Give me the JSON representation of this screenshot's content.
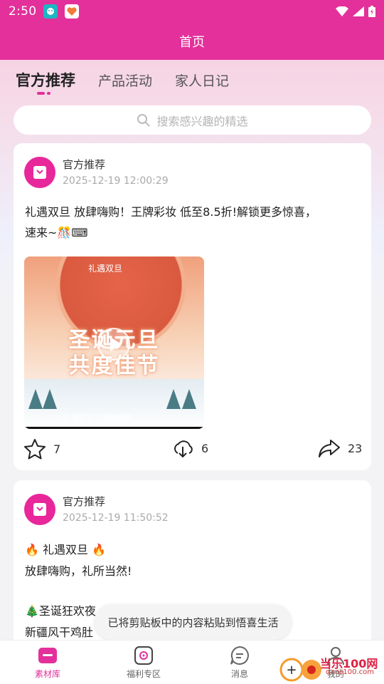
{
  "status_bar": {
    "time": "2:50"
  },
  "app_bar": {
    "title": "首页"
  },
  "tabs": [
    {
      "label": "官方推荐",
      "active": true
    },
    {
      "label": "产品活动",
      "active": false
    },
    {
      "label": "家人日记",
      "active": false
    }
  ],
  "search": {
    "placeholder": "搜索感兴趣的精选"
  },
  "posts": [
    {
      "author": "官方推荐",
      "time": "2025-12-19 12:00:29",
      "text_line1": " 礼遇双旦  放肆嗨购！王牌彩妆 低至8.5折!解锁更多惊喜，",
      "text_line2": "速来~🎊⌨",
      "video": {
        "top_text": "礼遇双旦",
        "headline_1": "圣诞元旦",
        "headline_2": "共度佳节",
        "caption": "礼遇双旦 · 放肆嗨购"
      },
      "likes": "7",
      "downloads": "6",
      "shares": "23"
    },
    {
      "author": "官方推荐",
      "time": "2025-12-19 11:50:52",
      "line1": "🔥 礼遇双旦 🔥",
      "line2": "放肆嗨购，礼所当然!",
      "line3": "🎄圣诞狂欢夜",
      "line4": "新疆风干鸡肚"
    }
  ],
  "toast": "已将剪贴板中的内容粘贴到悟喜生活",
  "bottom_nav": [
    {
      "label": "素材库",
      "active": true
    },
    {
      "label": "福利专区",
      "active": false
    },
    {
      "label": "消息",
      "active": false
    },
    {
      "label": "我的",
      "active": false
    }
  ],
  "watermark": {
    "brand": "当乐100网",
    "domain": "danji100.com"
  },
  "colors": {
    "brand": "#e3309a",
    "accent_avatar": "#e8279b"
  }
}
